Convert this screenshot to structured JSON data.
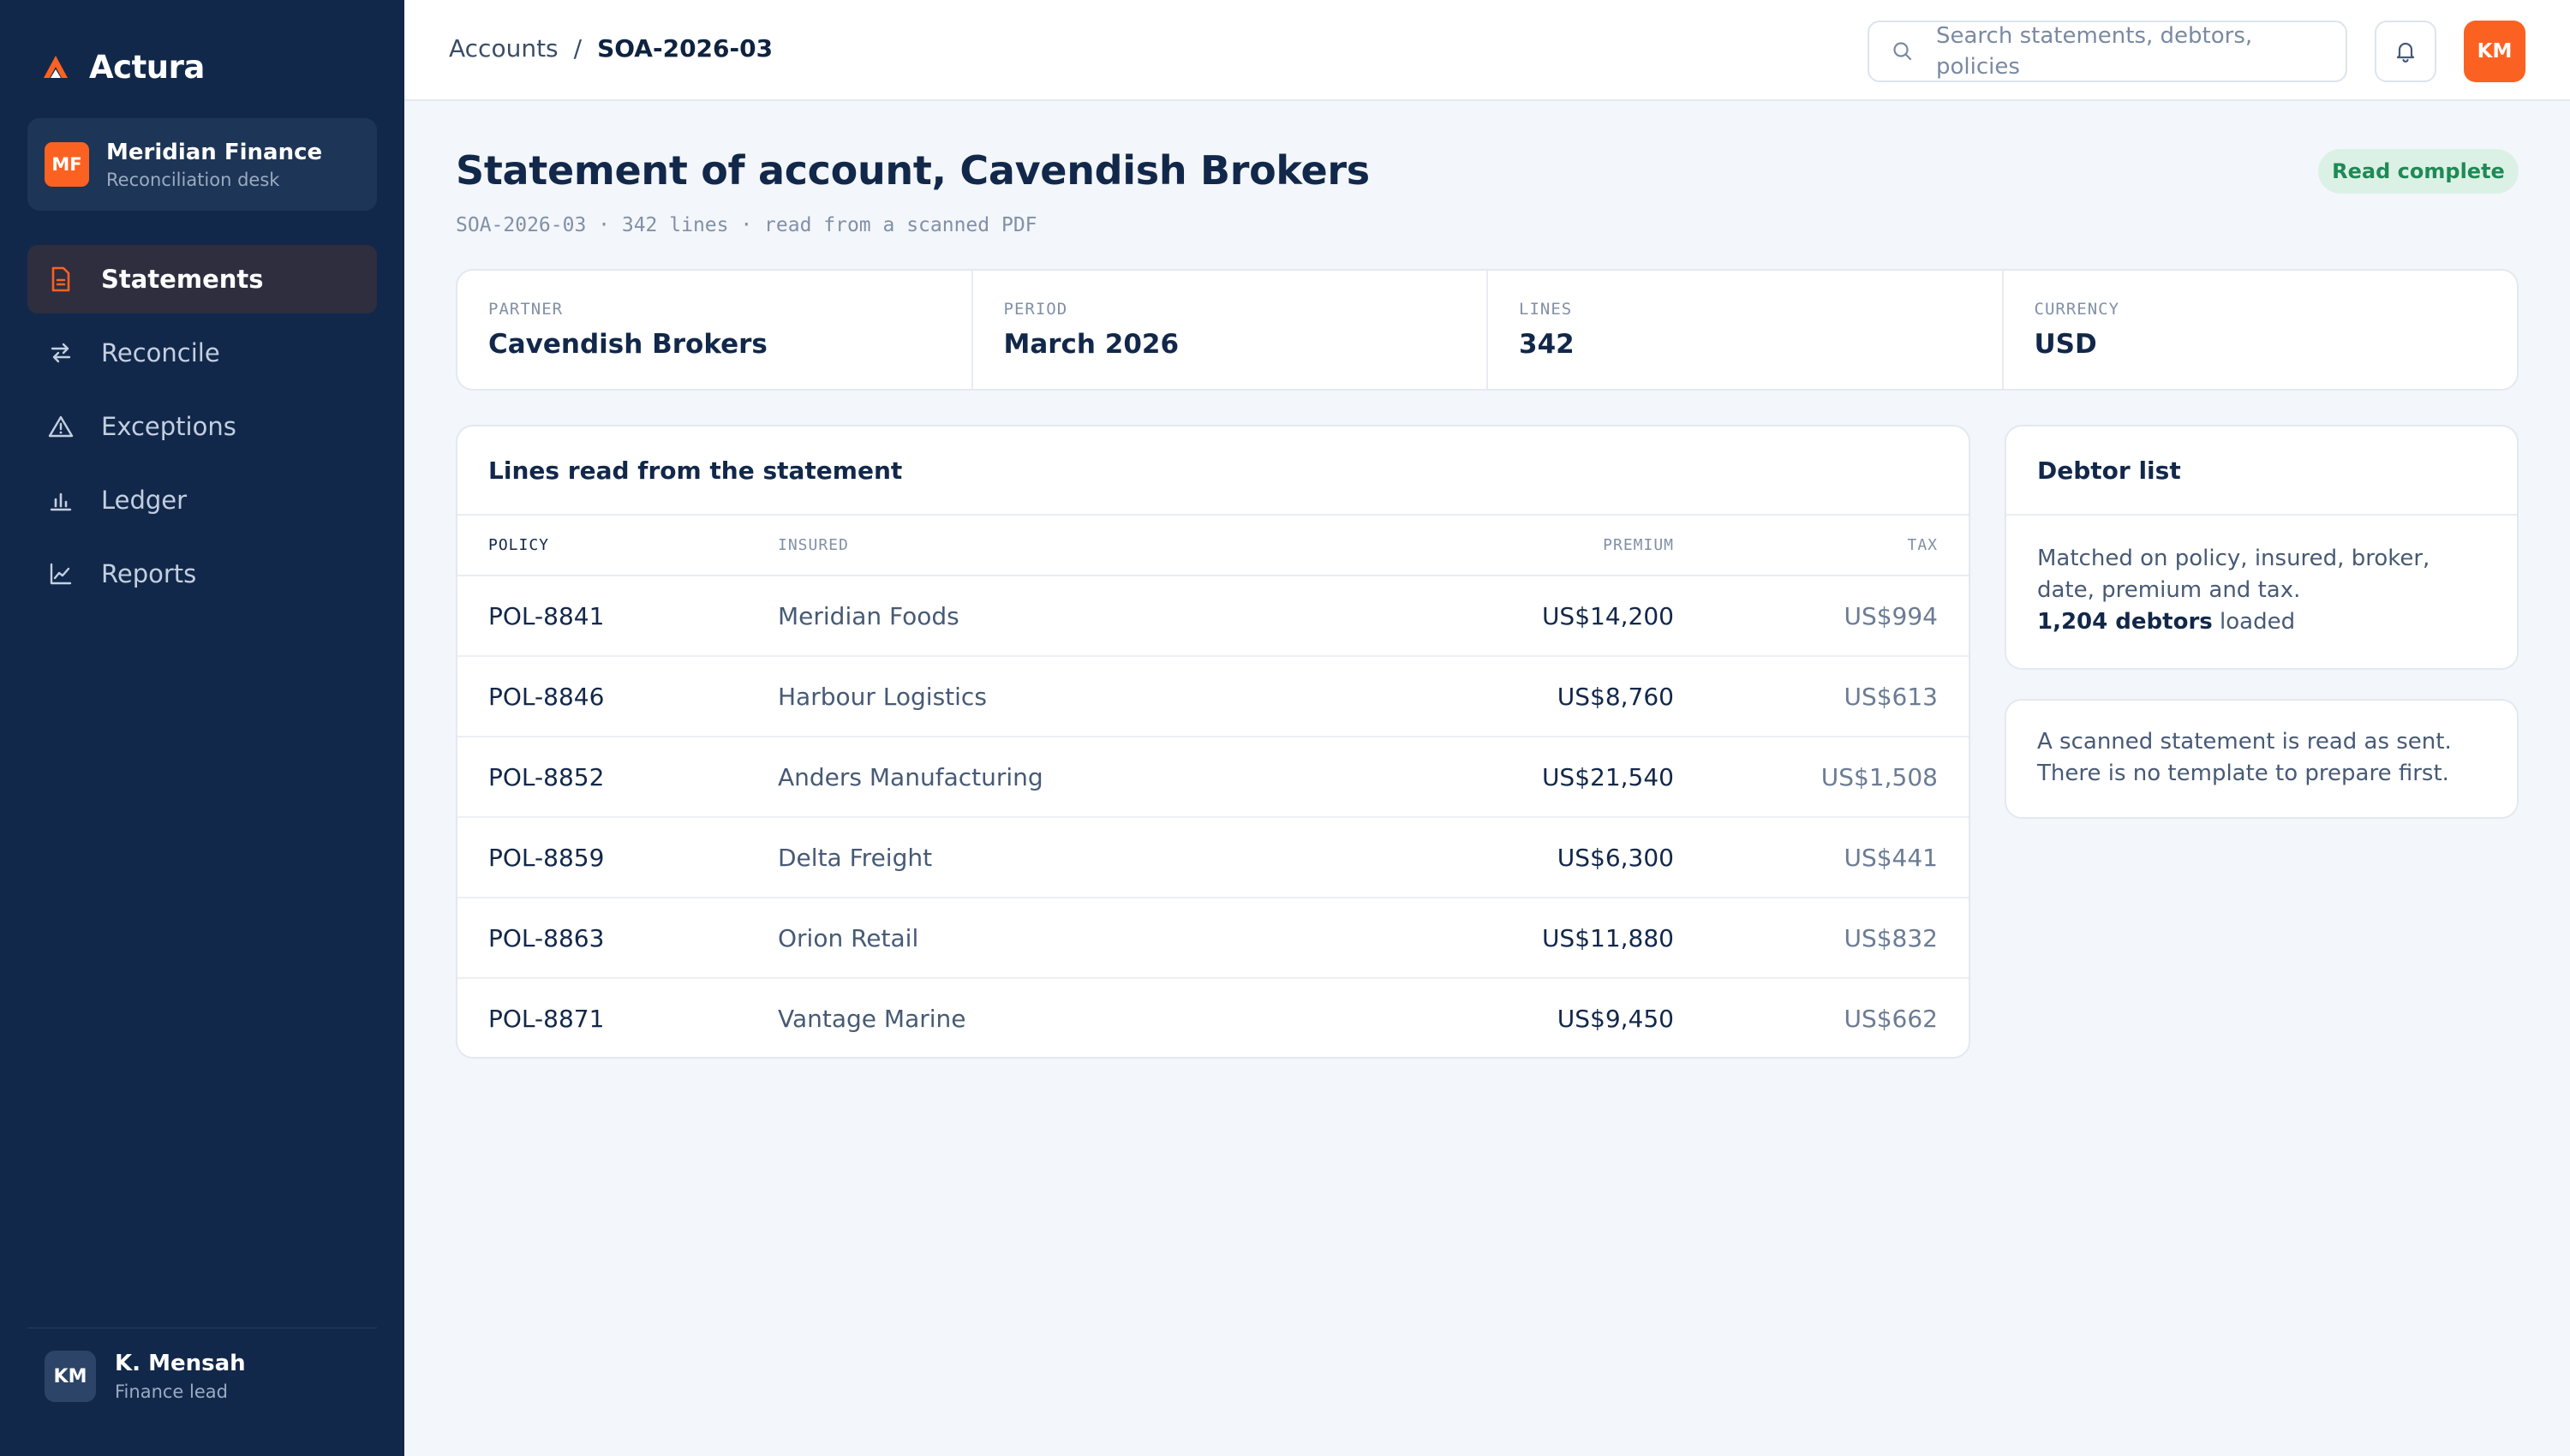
{
  "brand": {
    "name": "Actura",
    "accent": "#fb6221",
    "sidebar_bg": "#12284a"
  },
  "org": {
    "initials": "MF",
    "name": "Meridian Finance",
    "subtitle": "Reconciliation desk"
  },
  "nav": [
    {
      "label": "Statements",
      "icon": "document-icon",
      "active": true
    },
    {
      "label": "Reconcile",
      "icon": "arrows-swap-icon",
      "active": false
    },
    {
      "label": "Exceptions",
      "icon": "warning-triangle-icon",
      "active": false
    },
    {
      "label": "Ledger",
      "icon": "bar-chart-icon",
      "active": false
    },
    {
      "label": "Reports",
      "icon": "line-chart-icon",
      "active": false
    }
  ],
  "user": {
    "initials": "KM",
    "name": "K. Mensah",
    "role": "Finance lead"
  },
  "topbar": {
    "breadcrumb": {
      "parent": "Accounts",
      "separator": "/",
      "current": "SOA-2026-03"
    },
    "search_placeholder": "Search statements, debtors, policies",
    "user_initials": "KM"
  },
  "header": {
    "title": "Statement of account, Cavendish Brokers",
    "meta": "SOA-2026-03 · 342 lines · read from a scanned PDF",
    "status": "Read complete"
  },
  "summary": [
    {
      "label": "PARTNER",
      "value": "Cavendish Brokers"
    },
    {
      "label": "PERIOD",
      "value": "March 2026"
    },
    {
      "label": "LINES",
      "value": "342"
    },
    {
      "label": "CURRENCY",
      "value": "USD"
    }
  ],
  "lines": {
    "title": "Lines read from the statement",
    "columns": {
      "policy": "POLICY",
      "insured": "INSURED",
      "premium": "PREMIUM",
      "tax": "TAX"
    },
    "rows": [
      {
        "policy": "POL-8841",
        "insured": "Meridian Foods",
        "premium": "US$14,200",
        "tax": "US$994"
      },
      {
        "policy": "POL-8846",
        "insured": "Harbour Logistics",
        "premium": "US$8,760",
        "tax": "US$613"
      },
      {
        "policy": "POL-8852",
        "insured": "Anders Manufacturing",
        "premium": "US$21,540",
        "tax": "US$1,508"
      },
      {
        "policy": "POL-8859",
        "insured": "Delta Freight",
        "premium": "US$6,300",
        "tax": "US$441"
      },
      {
        "policy": "POL-8863",
        "insured": "Orion Retail",
        "premium": "US$11,880",
        "tax": "US$832"
      },
      {
        "policy": "POL-8871",
        "insured": "Vantage Marine",
        "premium": "US$9,450",
        "tax": "US$662"
      }
    ]
  },
  "debtor": {
    "title": "Debtor list",
    "description": "Matched on policy, insured, broker, date, premium and tax.",
    "count": "1,204 debtors",
    "count_suffix": " loaded"
  },
  "note": {
    "line1": "A scanned statement is read as sent.",
    "line2": "There is no template to prepare first."
  }
}
